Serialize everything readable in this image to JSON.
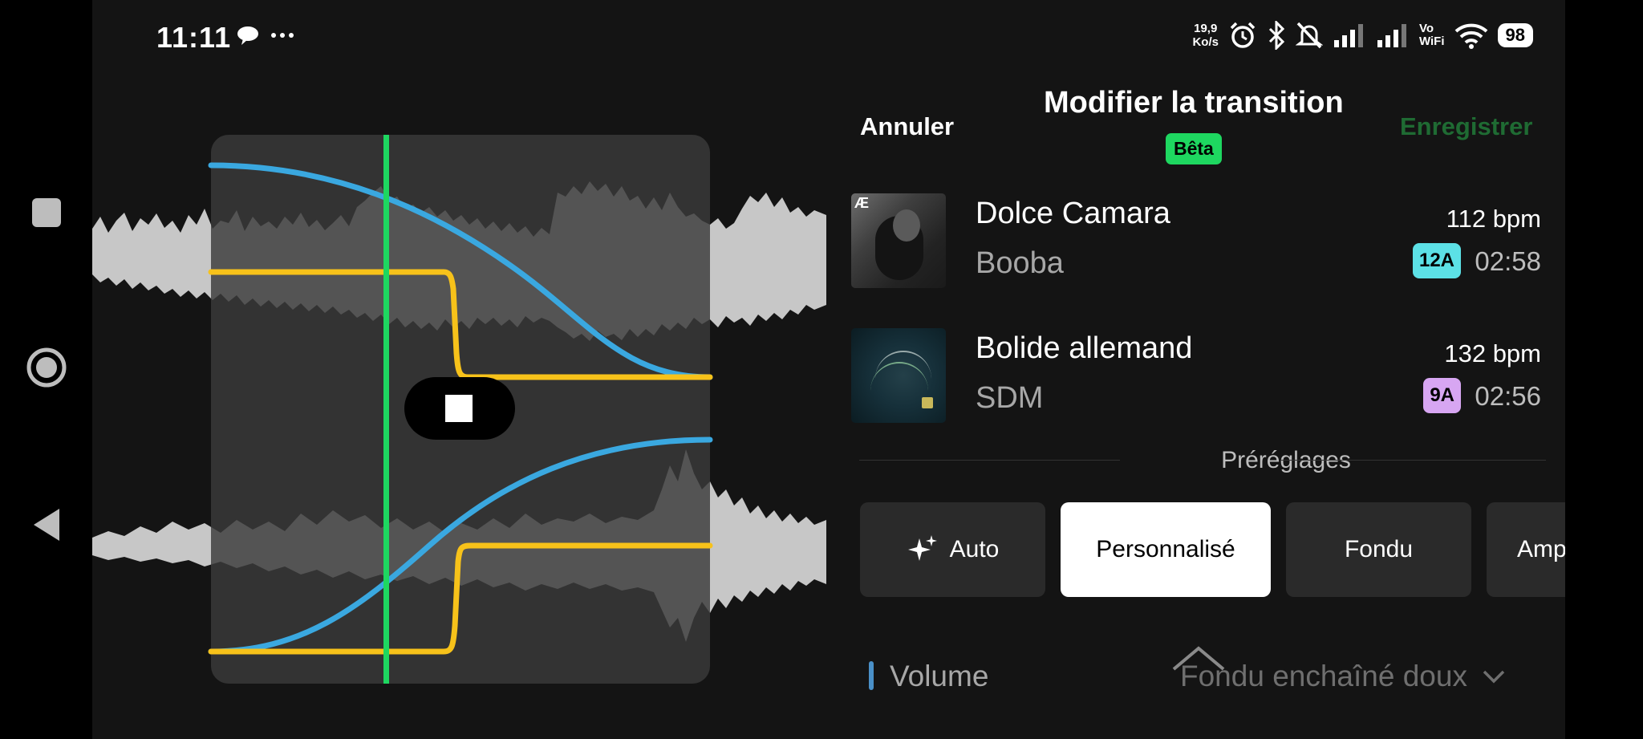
{
  "status": {
    "time": "11:11",
    "rate_top": "19,9",
    "rate_bottom": "Ko/s",
    "vowifi_top": "Vo",
    "vowifi_bottom": "WiFi",
    "battery": "98"
  },
  "header": {
    "cancel_label": "Annuler",
    "title": "Modifier la transition",
    "beta_label": "Bêta",
    "save_label": "Enregistrer"
  },
  "tracks": [
    {
      "title": "Dolce Camara",
      "artist": "Booba",
      "bpm": "112 bpm",
      "key": "12A",
      "key_color": "#5ce1e6",
      "duration": "02:58"
    },
    {
      "title": "Bolide allemand",
      "artist": "SDM",
      "bpm": "132 bpm",
      "key": "9A",
      "key_color": "#d7a6f2",
      "duration": "02:56"
    }
  ],
  "presets": {
    "section_label": "Préréglages",
    "items": [
      {
        "label": "Auto",
        "icon": "sparkle-icon",
        "active": false
      },
      {
        "label": "Personnalisé",
        "active": true
      },
      {
        "label": "Fondu",
        "active": false
      },
      {
        "label": "Amp",
        "active": false
      }
    ]
  },
  "volume": {
    "label": "Volume",
    "selected_option": "Fondu enchaîné doux"
  },
  "colors": {
    "outgoing_curve": "#3aa8e0",
    "eq_curve": "#f7c21a",
    "playhead": "#1ed760",
    "accent_green": "#1ed760",
    "save_disabled": "#1f6b33"
  },
  "icons": {
    "nav_recent": "square-icon",
    "nav_home": "circle-icon",
    "nav_back": "triangle-back-icon",
    "playback": "stop-icon"
  }
}
